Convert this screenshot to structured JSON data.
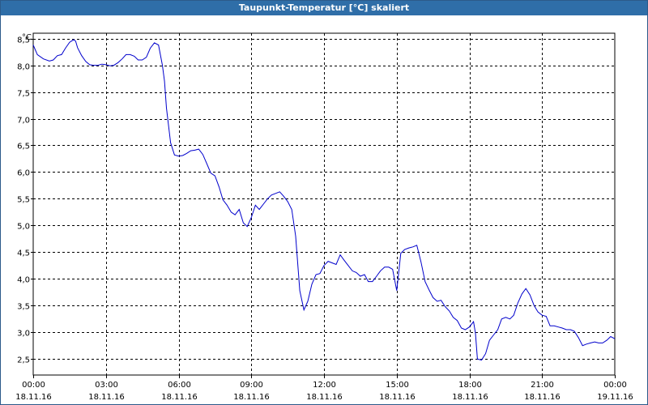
{
  "window": {
    "title": "Taupunkt-Temperatur [°C] skaliert"
  },
  "chart_data": {
    "type": "line",
    "title": "Taupunkt-Temperatur [°C] skaliert",
    "ylabel": "°C",
    "xlabel": "",
    "ylim": [
      2.2,
      8.6
    ],
    "yticks": [
      2.5,
      3.0,
      3.5,
      4.0,
      4.5,
      5.0,
      5.5,
      6.0,
      6.5,
      7.0,
      7.5,
      8.0,
      8.5
    ],
    "ytick_labels": [
      "2,5",
      "3,0",
      "3,5",
      "4,0",
      "4,5",
      "5,0",
      "5,5",
      "6,0",
      "6,5",
      "7,0",
      "7,5",
      "8,0",
      "8,5"
    ],
    "xlim_hours": [
      0,
      24
    ],
    "xticks": [
      {
        "hour": 0,
        "time": "00:00",
        "date": "18.11.16"
      },
      {
        "hour": 3,
        "time": "03:00",
        "date": "18.11.16"
      },
      {
        "hour": 6,
        "time": "06:00",
        "date": "18.11.16"
      },
      {
        "hour": 9,
        "time": "09:00",
        "date": "18.11.16"
      },
      {
        "hour": 12,
        "time": "12:00",
        "date": "18.11.16"
      },
      {
        "hour": 15,
        "time": "15:00",
        "date": "18.11.16"
      },
      {
        "hour": 18,
        "time": "18:00",
        "date": "18.11.16"
      },
      {
        "hour": 21,
        "time": "21:00",
        "date": "18.11.16"
      },
      {
        "hour": 24,
        "time": "00:00",
        "date": "19.11.16"
      }
    ],
    "grid": true,
    "series": [
      {
        "color": "#0000cc",
        "x": [
          0.0,
          0.17,
          0.42,
          0.67,
          0.83,
          1.0,
          1.17,
          1.33,
          1.5,
          1.67,
          1.75,
          1.83,
          2.0,
          2.17,
          2.33,
          2.5,
          2.67,
          2.83,
          3.0,
          3.17,
          3.33,
          3.5,
          3.67,
          3.83,
          4.0,
          4.17,
          4.33,
          4.5,
          4.67,
          4.83,
          5.0,
          5.17,
          5.33,
          5.42,
          5.5,
          5.67,
          5.83,
          6.0,
          6.17,
          6.33,
          6.5,
          6.67,
          6.83,
          7.0,
          7.17,
          7.33,
          7.5,
          7.67,
          7.83,
          8.0,
          8.17,
          8.33,
          8.5,
          8.67,
          8.83,
          9.0,
          9.17,
          9.33,
          9.5,
          9.67,
          9.83,
          10.0,
          10.17,
          10.33,
          10.5,
          10.67,
          10.83,
          11.0,
          11.17,
          11.33,
          11.5,
          11.67,
          11.83,
          12.0,
          12.17,
          12.33,
          12.5,
          12.67,
          12.83,
          13.0,
          13.17,
          13.33,
          13.5,
          13.67,
          13.83,
          14.0,
          14.17,
          14.33,
          14.5,
          14.67,
          14.83,
          15.0,
          15.17,
          15.33,
          15.5,
          15.67,
          15.83,
          16.0,
          16.17,
          16.33,
          16.5,
          16.67,
          16.83,
          17.0,
          17.17,
          17.33,
          17.5,
          17.67,
          17.83,
          18.0,
          18.17,
          18.25,
          18.33,
          18.5,
          18.67,
          18.83,
          19.0,
          19.17,
          19.33,
          19.5,
          19.67,
          19.83,
          20.0,
          20.17,
          20.33,
          20.5,
          20.67,
          20.83,
          21.0,
          21.17,
          21.33,
          21.5,
          21.67,
          21.83,
          22.0,
          22.17,
          22.33,
          22.5,
          22.67,
          22.83,
          23.0,
          23.17,
          23.33,
          23.5,
          23.67,
          23.83,
          24.0
        ],
        "y": [
          8.38,
          8.2,
          8.12,
          8.08,
          8.1,
          8.18,
          8.2,
          8.32,
          8.43,
          8.48,
          8.45,
          8.33,
          8.18,
          8.07,
          8.01,
          8.0,
          8.0,
          8.02,
          8.01,
          7.99,
          8.0,
          8.05,
          8.12,
          8.2,
          8.2,
          8.17,
          8.1,
          8.1,
          8.15,
          8.32,
          8.42,
          8.38,
          8.0,
          7.7,
          7.2,
          6.55,
          6.32,
          6.3,
          6.31,
          6.35,
          6.4,
          6.41,
          6.43,
          6.33,
          6.15,
          5.98,
          5.93,
          5.72,
          5.48,
          5.38,
          5.25,
          5.2,
          5.3,
          5.05,
          4.98,
          5.15,
          5.38,
          5.3,
          5.4,
          5.5,
          5.57,
          5.6,
          5.63,
          5.55,
          5.45,
          5.3,
          4.8,
          3.78,
          3.42,
          3.58,
          3.9,
          4.08,
          4.1,
          4.25,
          4.33,
          4.3,
          4.27,
          4.45,
          4.35,
          4.25,
          4.15,
          4.12,
          4.05,
          4.08,
          3.95,
          3.95,
          4.05,
          4.15,
          4.22,
          4.22,
          4.18,
          3.78,
          4.48,
          4.55,
          4.58,
          4.6,
          4.63,
          4.32,
          3.95,
          3.8,
          3.65,
          3.58,
          3.6,
          3.48,
          3.4,
          3.28,
          3.22,
          3.08,
          3.05,
          3.1,
          3.2,
          2.98,
          2.5,
          2.48,
          2.6,
          2.85,
          2.95,
          3.05,
          3.25,
          3.28,
          3.25,
          3.32,
          3.55,
          3.72,
          3.82,
          3.7,
          3.5,
          3.38,
          3.32,
          3.3,
          3.12,
          3.12,
          3.1,
          3.08,
          3.05,
          3.05,
          3.02,
          2.9,
          2.75,
          2.78,
          2.8,
          2.82,
          2.8,
          2.8,
          2.85,
          2.92,
          2.88
        ]
      }
    ]
  }
}
